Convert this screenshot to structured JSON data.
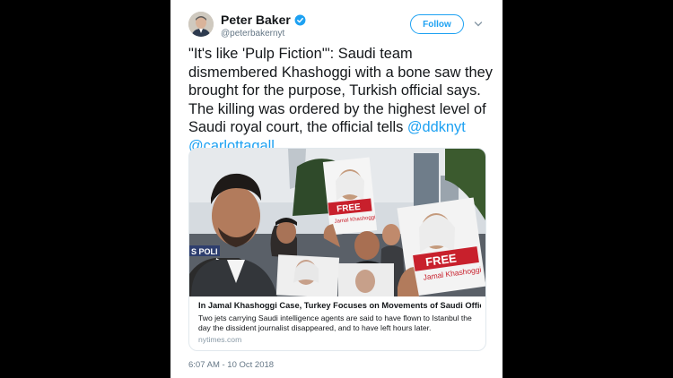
{
  "author": {
    "name": "Peter Baker",
    "handle": "@peterbakernyt",
    "verified": true,
    "avatar_icon": "person-avatar"
  },
  "follow_button": {
    "label": "Follow"
  },
  "menu": {
    "icon": "chevron-down-icon"
  },
  "tweet": {
    "text": "\"It's like 'Pulp Fiction'\": Saudi team dismembered Khashoggi with a bone saw they brought for the purpose, Turkish official says. The killing was ordered by the highest level of Saudi royal court, the official tells ",
    "mentions": [
      "@ddknyt",
      "@carlottagall"
    ]
  },
  "card": {
    "image": {
      "sign_free": "FREE",
      "sign_name": "Jamal Khashoggi",
      "police_text": "S POLI"
    },
    "title": "In Jamal Khashoggi Case, Turkey Focuses on Movements of Saudi Officials",
    "description": "Two jets carrying Saudi intelligence agents are said to have flown to Istanbul the day the dissident journalist disappeared, and to have left hours later.",
    "domain": "nytimes.com"
  },
  "timestamp": "6:07 AM - 10 Oct 2018",
  "colors": {
    "accent": "#1da1f2",
    "text": "#14171a",
    "secondary": "#657786",
    "background": "#000000",
    "sign_red": "#c8202c"
  }
}
